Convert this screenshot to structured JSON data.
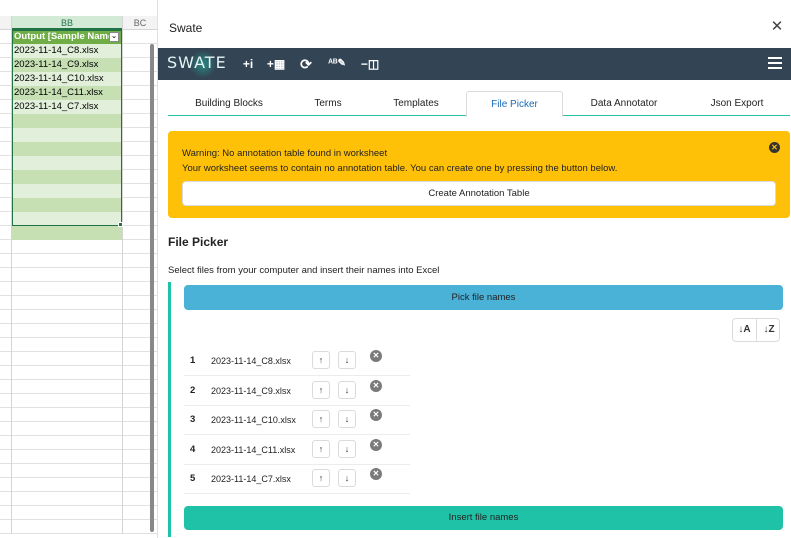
{
  "sheet": {
    "col_bb": "BB",
    "col_bc": "BC",
    "header_cell": "Output [Sample Name]",
    "dropdown_glyph": "⌄",
    "cells": [
      "2023-11-14_C8.xlsx",
      "2023-11-14_C9.xlsx",
      "2023-11-14_C10.xlsx",
      "2023-11-14_C11.xlsx",
      "2023-11-14_C7.xlsx"
    ],
    "colors": {
      "header": "#70ad47",
      "band_dark": "#c6e0b4",
      "band_light": "#e2efda",
      "accent": "#217346"
    }
  },
  "pane": {
    "title": "Swate",
    "close": "✕",
    "logo": "SWATE",
    "toolbar": [
      {
        "name": "add-column-icon",
        "glyph": "+i"
      },
      {
        "name": "add-table-icon",
        "glyph": "+▦"
      },
      {
        "name": "refresh-icon",
        "glyph": "⟳"
      },
      {
        "name": "autocomplete-edit-icon",
        "glyph": "ᴬᴮ✎"
      },
      {
        "name": "remove-column-icon",
        "glyph": "−◫"
      }
    ],
    "tabs": [
      "Building Blocks",
      "Terms",
      "Templates",
      "File Picker",
      "Data Annotator",
      "Json Export"
    ],
    "active_tab": "File Picker",
    "warning": {
      "title": "Warning: No annotation table found in worksheet",
      "text": "Your worksheet seems to contain no annotation table. You can create one by pressing the button below.",
      "button": "Create Annotation Table",
      "dismiss": "✕"
    },
    "file_picker": {
      "title": "File Picker",
      "description": "Select files from your computer and insert their names into Excel",
      "pick_button": "Pick file names",
      "sort_asc": "↓A",
      "sort_desc": "↓Z",
      "move_up": "↑",
      "move_down": "↓",
      "remove": "✕",
      "files": [
        {
          "index": "1",
          "name": "2023-11-14_C8.xlsx"
        },
        {
          "index": "2",
          "name": "2023-11-14_C9.xlsx"
        },
        {
          "index": "3",
          "name": "2023-11-14_C10.xlsx"
        },
        {
          "index": "4",
          "name": "2023-11-14_C11.xlsx"
        },
        {
          "index": "5",
          "name": "2023-11-14_C7.xlsx"
        }
      ],
      "insert_button": "Insert file names"
    },
    "colors": {
      "navbar": "#334455",
      "primary": "#1fc2a7",
      "info": "#4ab1d7",
      "warning": "#ffc107",
      "tab_active": "#1a6bb8"
    }
  }
}
